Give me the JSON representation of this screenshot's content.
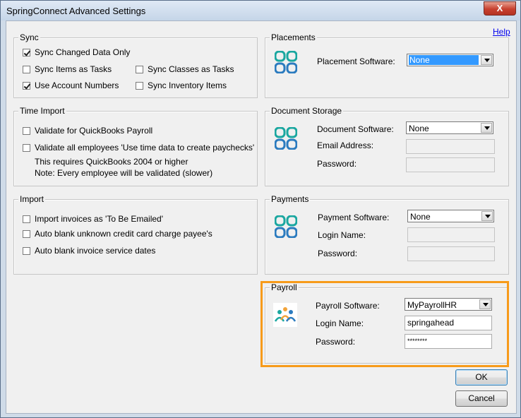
{
  "window": {
    "title": "SpringConnect Advanced Settings",
    "close_label": "X",
    "help_label": "Help"
  },
  "sync": {
    "legend": "Sync",
    "items": [
      {
        "label": "Sync Changed Data Only",
        "checked": true
      },
      {
        "label": "Sync Items as Tasks",
        "checked": false
      },
      {
        "label": "Sync Classes as Tasks",
        "checked": false
      },
      {
        "label": "Use Account Numbers",
        "checked": true
      },
      {
        "label": "Sync Inventory Items",
        "checked": false
      }
    ]
  },
  "time_import": {
    "legend": "Time Import",
    "items": [
      {
        "label": "Validate for QuickBooks Payroll",
        "checked": false
      },
      {
        "label": "Validate all employees 'Use time data to create paychecks'",
        "checked": false
      }
    ],
    "note1": "This requires QuickBooks 2004 or higher",
    "note2": "Note: Every employee will be validated (slower)"
  },
  "import": {
    "legend": "Import",
    "items": [
      {
        "label": "Import invoices as 'To Be Emailed'",
        "checked": false
      },
      {
        "label": "Auto blank unknown credit card charge payee's",
        "checked": false
      },
      {
        "label": "Auto blank invoice service dates",
        "checked": false
      }
    ]
  },
  "placements": {
    "legend": "Placements",
    "software_label": "Placement Software:",
    "software_value": "None"
  },
  "document_storage": {
    "legend": "Document Storage",
    "software_label": "Document Software:",
    "software_value": "None",
    "email_label": "Email Address:",
    "email_value": "",
    "password_label": "Password:",
    "password_value": ""
  },
  "payments": {
    "legend": "Payments",
    "software_label": "Payment Software:",
    "software_value": "None",
    "login_label": "Login Name:",
    "login_value": "",
    "password_label": "Password:",
    "password_value": ""
  },
  "payroll": {
    "legend": "Payroll",
    "software_label": "Payroll Software:",
    "software_value": "MyPayrollHR",
    "login_label": "Login Name:",
    "login_value": "springahead",
    "password_label": "Password:",
    "password_value": "********"
  },
  "buttons": {
    "ok_label": "OK",
    "cancel_label": "Cancel"
  },
  "colors": {
    "highlight": "#f79b1b",
    "logo_teal": "#1aa7a0",
    "logo_blue": "#2b7bbf"
  }
}
